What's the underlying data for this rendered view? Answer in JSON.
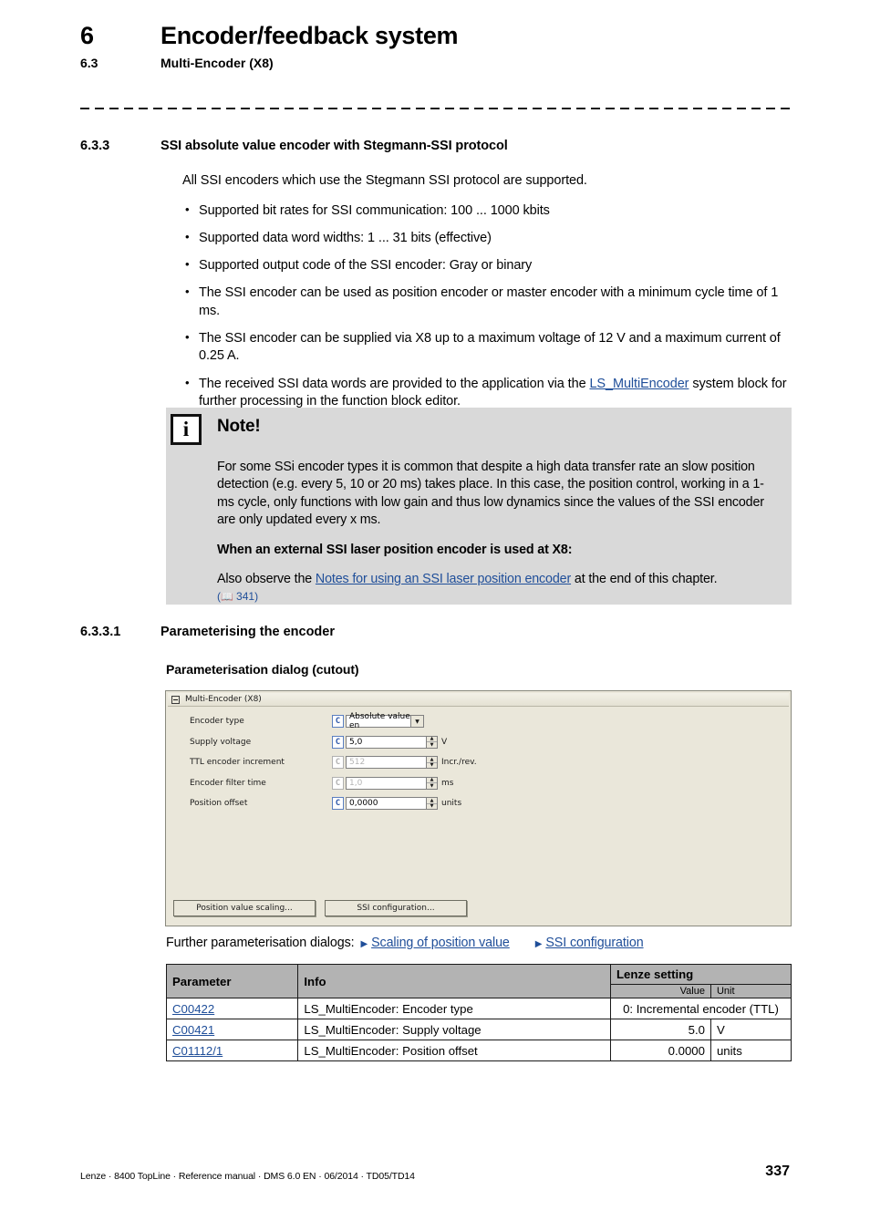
{
  "header": {
    "chapter_number": "6",
    "chapter_title": "Encoder/feedback system",
    "section_number": "6.3",
    "section_title": "Multi-Encoder (X8)"
  },
  "section": {
    "number": "6.3.3",
    "title": "SSI absolute value encoder with Stegmann-SSI protocol",
    "intro": "All SSI encoders which use the Stegmann SSI protocol are supported.",
    "bullets": [
      {
        "text": "Supported bit rates for SSI communication: 100 ... 1000 kbits"
      },
      {
        "text": "Supported data word widths: 1 ... 31 bits (effective)"
      },
      {
        "text": "Supported output code of the SSI encoder: Gray or binary"
      },
      {
        "text": "The SSI encoder can be used as position encoder or master encoder with a minimum cycle time of 1 ms."
      },
      {
        "text": "The SSI encoder can be supplied via X8 up to a maximum voltage of 12 V and a maximum current of 0.25 A."
      },
      {
        "pre": "The received SSI data words are provided to the application via the ",
        "link": "LS_MultiEncoder",
        "post": " system block for further processing in the function block editor."
      }
    ]
  },
  "note": {
    "icon": "info-icon",
    "title": "Note!",
    "paragraph1": "For some SSi encoder types it is common that despite a high data transfer rate an slow position detection (e.g. every 5, 10 or 20 ms) takes place. In this case, the position control, working in a 1-ms cycle, only functions with low gain and thus low dynamics since the values of the SSI encoder are only updated every x ms.",
    "paragraph2_bold": "When an external SSI laser position encoder is used at X8:",
    "paragraph3_pre": "Also observe the ",
    "paragraph3_link": "Notes for using an SSI laser position encoder",
    "paragraph3_post": " at the end of this chapter.",
    "page_ref": "341"
  },
  "subsection": {
    "number": "6.3.3.1",
    "title": "Parameterising the encoder",
    "dialog_caption": "Parameterisation dialog (cutout)"
  },
  "dialog": {
    "title": "Multi-Encoder (X8)",
    "fields": [
      {
        "label": "Encoder type",
        "value": "Absolute value en",
        "unit": "",
        "type": "combo",
        "disabled": false
      },
      {
        "label": "Supply voltage",
        "value": "5,0",
        "unit": "V",
        "type": "spinner",
        "disabled": false
      },
      {
        "label": "TTL encoder increment",
        "value": "512",
        "unit": "Incr./rev.",
        "type": "spinner",
        "disabled": true
      },
      {
        "label": "Encoder filter time",
        "value": "1,0",
        "unit": "ms",
        "type": "spinner",
        "disabled": true
      },
      {
        "label": "Position offset",
        "value": "0,0000",
        "unit": "units",
        "type": "spinner",
        "disabled": false
      }
    ],
    "badge_label": "C",
    "buttons": [
      {
        "label": "Position value scaling..."
      },
      {
        "label": "SSI configuration..."
      }
    ]
  },
  "further": {
    "label": "Further parameterisation dialogs:",
    "links": [
      {
        "text": "Scaling of position value"
      },
      {
        "text": "SSI configuration"
      }
    ]
  },
  "table": {
    "headers": {
      "parameter": "Parameter",
      "info": "Info",
      "lenze_setting": "Lenze setting",
      "value": "Value",
      "unit": "Unit"
    },
    "rows": [
      {
        "parameter": "C00422",
        "info": "LS_MultiEncoder: Encoder type",
        "value": "0: Incremental encoder (TTL)",
        "unit": "",
        "span": true
      },
      {
        "parameter": "C00421",
        "info": "LS_MultiEncoder: Supply voltage",
        "value": "5.0",
        "unit": "V",
        "span": false
      },
      {
        "parameter": "C01112/1",
        "info": "LS_MultiEncoder: Position offset",
        "value": "0.0000",
        "unit": "units",
        "span": false
      }
    ]
  },
  "footer": {
    "left": "Lenze · 8400 TopLine · Reference manual · DMS 6.0 EN · 06/2014 · TD05/TD14",
    "page": "337"
  },
  "colors": {
    "link": "#1F4E99",
    "note_bg": "#D9D9D9",
    "dialog_bg": "#EAE7DA",
    "table_header_bg": "#B3B3B3"
  }
}
